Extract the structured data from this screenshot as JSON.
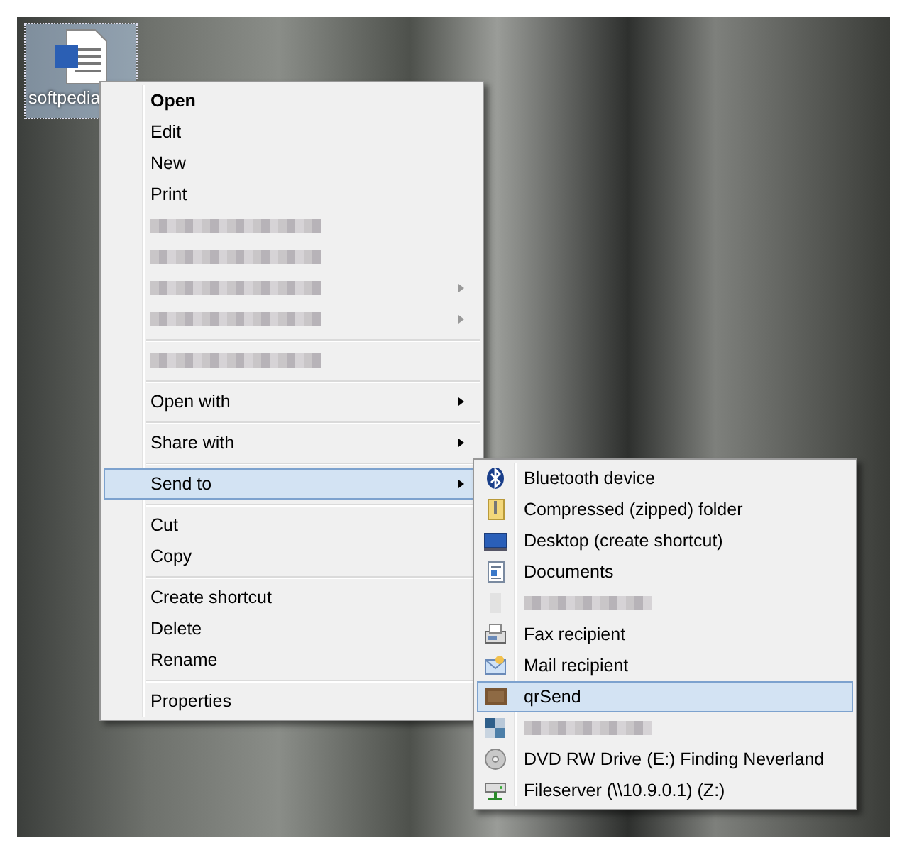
{
  "desktop_icon": {
    "label": "softpedia",
    "selected": true
  },
  "context_menu": {
    "items": [
      {
        "kind": "item",
        "label": "Open",
        "default": true,
        "submenu": false,
        "selected": false
      },
      {
        "kind": "item",
        "label": "Edit",
        "default": false,
        "submenu": false,
        "selected": false
      },
      {
        "kind": "item",
        "label": "New",
        "default": false,
        "submenu": false,
        "selected": false
      },
      {
        "kind": "item",
        "label": "Print",
        "default": false,
        "submenu": false,
        "selected": false
      },
      {
        "kind": "blurred",
        "submenu": false,
        "selected": false
      },
      {
        "kind": "blurred",
        "submenu": false,
        "selected": false
      },
      {
        "kind": "blurred",
        "submenu": true,
        "selected": false
      },
      {
        "kind": "blurred",
        "submenu": true,
        "selected": false
      },
      {
        "kind": "separator"
      },
      {
        "kind": "blurred",
        "submenu": false,
        "selected": false
      },
      {
        "kind": "separator"
      },
      {
        "kind": "item",
        "label": "Open with",
        "default": false,
        "submenu": true,
        "selected": false
      },
      {
        "kind": "separator"
      },
      {
        "kind": "item",
        "label": "Share with",
        "default": false,
        "submenu": true,
        "selected": false
      },
      {
        "kind": "separator"
      },
      {
        "kind": "item",
        "label": "Send to",
        "default": false,
        "submenu": true,
        "selected": true
      },
      {
        "kind": "separator"
      },
      {
        "kind": "item",
        "label": "Cut",
        "default": false,
        "submenu": false,
        "selected": false
      },
      {
        "kind": "item",
        "label": "Copy",
        "default": false,
        "submenu": false,
        "selected": false
      },
      {
        "kind": "separator"
      },
      {
        "kind": "item",
        "label": "Create shortcut",
        "default": false,
        "submenu": false,
        "selected": false
      },
      {
        "kind": "item",
        "label": "Delete",
        "default": false,
        "submenu": false,
        "selected": false
      },
      {
        "kind": "item",
        "label": "Rename",
        "default": false,
        "submenu": false,
        "selected": false
      },
      {
        "kind": "separator"
      },
      {
        "kind": "item",
        "label": "Properties",
        "default": false,
        "submenu": false,
        "selected": false
      }
    ]
  },
  "send_to_menu": {
    "items": [
      {
        "kind": "item",
        "label": "Bluetooth device",
        "selected": false
      },
      {
        "kind": "item",
        "label": "Compressed (zipped) folder",
        "selected": false
      },
      {
        "kind": "item",
        "label": "Desktop (create shortcut)",
        "selected": false
      },
      {
        "kind": "item",
        "label": "Documents",
        "selected": false
      },
      {
        "kind": "blurred",
        "selected": false
      },
      {
        "kind": "item",
        "label": "Fax recipient",
        "selected": false
      },
      {
        "kind": "item",
        "label": "Mail recipient",
        "selected": false
      },
      {
        "kind": "item",
        "label": "qrSend",
        "selected": true
      },
      {
        "kind": "blurred",
        "selected": false
      },
      {
        "kind": "item",
        "label": "DVD RW Drive (E:) Finding Neverland",
        "selected": false
      },
      {
        "kind": "item",
        "label": "Fileserver (\\\\10.9.0.1) (Z:)",
        "selected": false
      }
    ]
  }
}
